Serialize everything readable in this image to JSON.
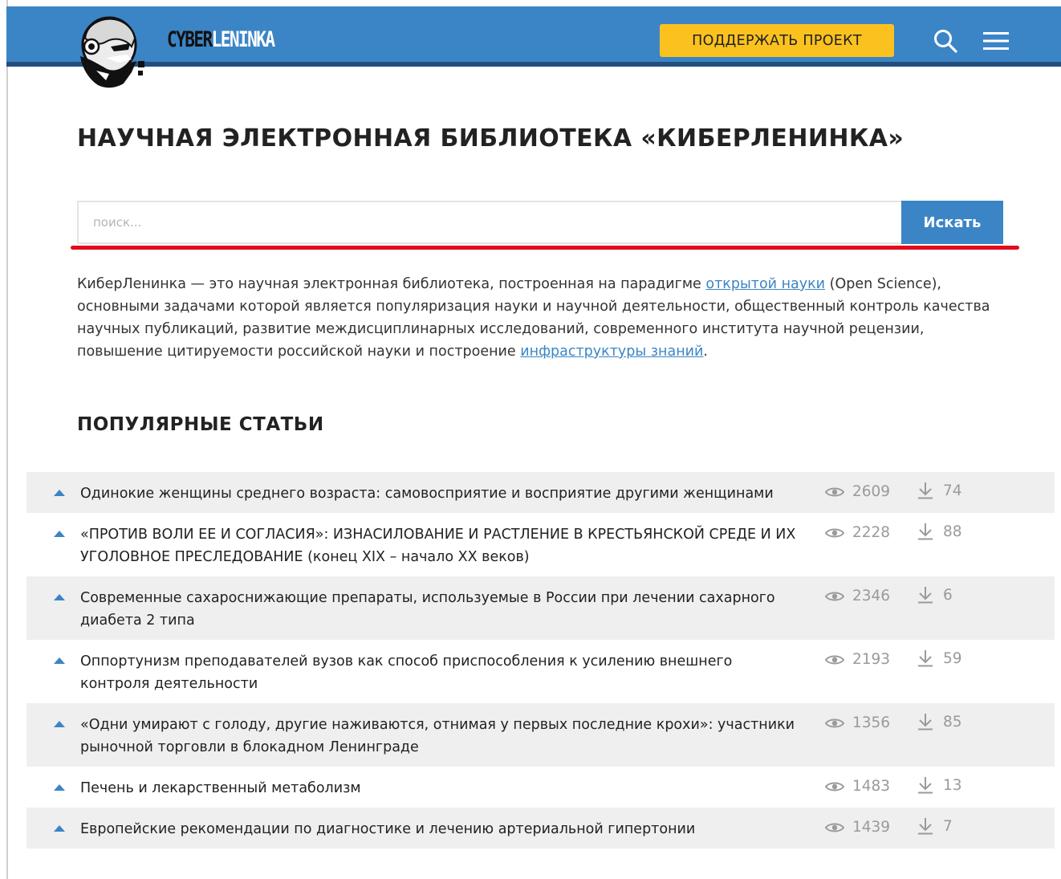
{
  "header": {
    "logo_part1": "CYBER",
    "logo_part2": "LENINKA",
    "support_label": "ПОДДЕРЖАТЬ ПРОЕКТ",
    "accent_color": "#3b85c6",
    "support_color": "#fbc21f"
  },
  "page_title": "НАУЧНАЯ ЭЛЕКТРОННАЯ БИБЛИОТЕКА «КИБЕРЛЕНИНКА»",
  "search": {
    "placeholder": "поиск...",
    "value": "",
    "button_label": "Искать"
  },
  "intro": {
    "part1": "КиберЛенинка — это научная электронная библиотека, построенная на парадигме ",
    "link1": "открытой науки",
    "part2": " (Open Science), основными задачами которой является популяризация науки и научной деятельности, общественный контроль качества научных публикаций, развитие междисциплинарных исследований, современного института научной рецензии, повышение цитируемости российской науки и построение ",
    "link2": "инфраструктуры знаний",
    "part3": "."
  },
  "popular": {
    "title": "ПОПУЛЯРНЫЕ СТАТЬИ",
    "articles": [
      {
        "title": "Одинокие женщины среднего возраста: самовосприятие и восприятие другими женщинами",
        "views": "2609",
        "downloads": "74"
      },
      {
        "title": "«ПРОТИВ ВОЛИ ЕЕ И СОГЛАСИЯ»: ИЗНАСИЛОВАНИЕ И РАСТЛЕНИЕ В КРЕСТЬЯНСКОЙ СРЕДЕ И ИХ УГОЛОВНОЕ ПРЕСЛЕДОВАНИЕ (конец XIX – начало XX веков)",
        "views": "2228",
        "downloads": "88"
      },
      {
        "title": "Современные сахароснижающие препараты, используемые в России при лечении сахарного диабета 2 типа",
        "views": "2346",
        "downloads": "6"
      },
      {
        "title": "Оппортунизм преподавателей вузов как способ приспособления к усилению внешнего контроля деятельности",
        "views": "2193",
        "downloads": "59"
      },
      {
        "title": "«Одни умирают с голоду, другие наживаются, отнимая у первых последние крохи»: участники рыночной торговли в блокадном Ленинграде",
        "views": "1356",
        "downloads": "85"
      },
      {
        "title": "Печень и лекарственный метаболизм",
        "views": "1483",
        "downloads": "13"
      },
      {
        "title": "Европейские рекомендации по диагностике и лечению артериальной гипертонии",
        "views": "1439",
        "downloads": "7"
      }
    ]
  }
}
